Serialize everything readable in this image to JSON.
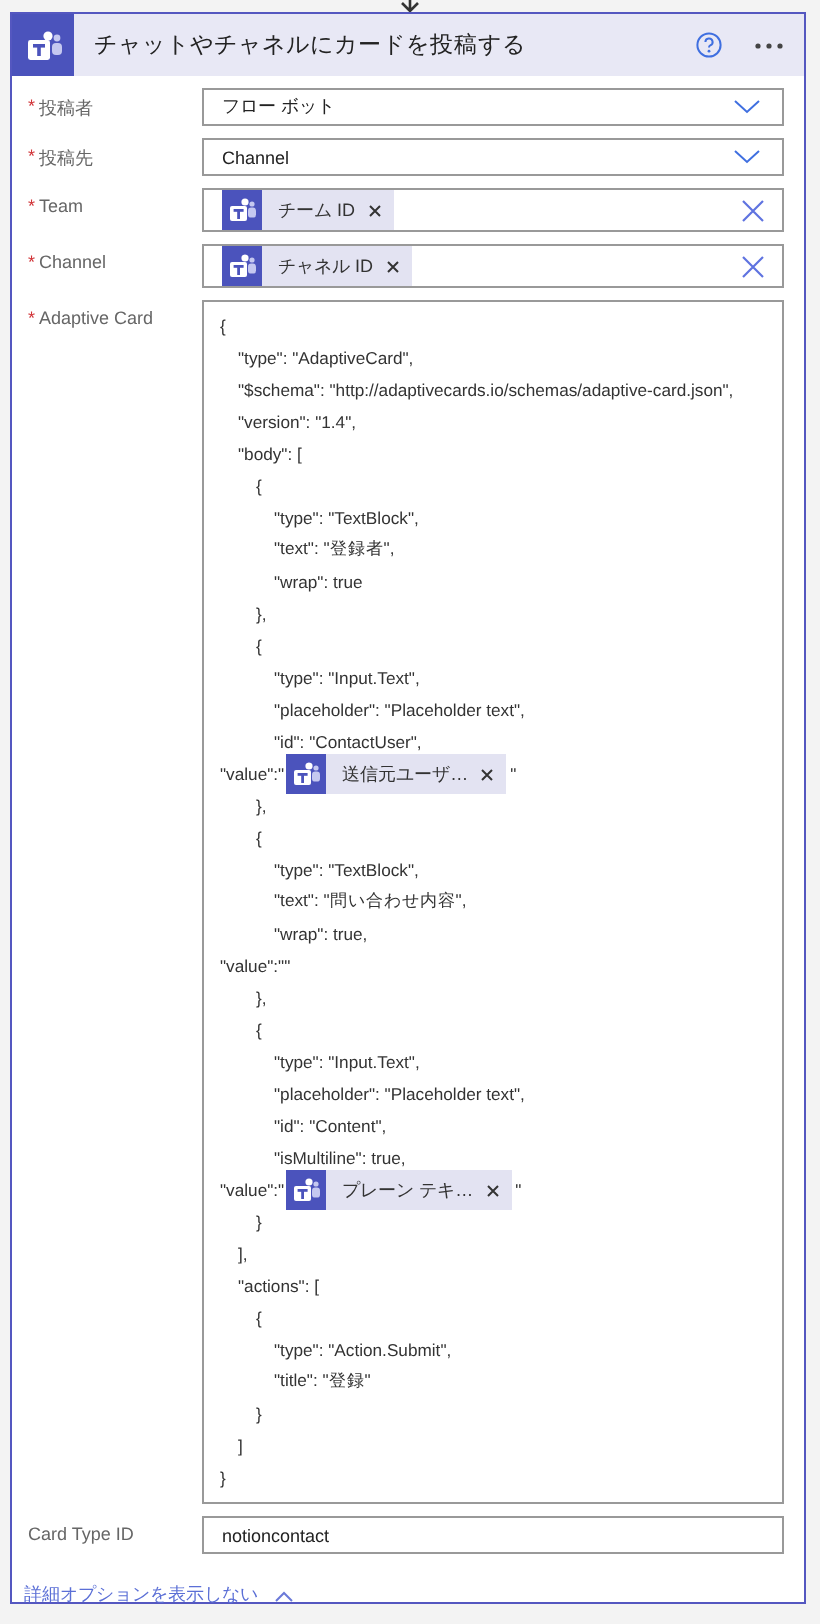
{
  "card": {
    "title": "チャットやチャネルにカードを投稿する"
  },
  "fields": [
    {
      "kind": "dropdown",
      "required_mark": "*",
      "label": "投稿者",
      "value": "フロー ボット"
    },
    {
      "kind": "dropdown",
      "required_mark": "*",
      "label": "投稿先",
      "value": "Channel"
    },
    {
      "kind": "tokens",
      "required_mark": "*",
      "label": "Team",
      "tokens": [
        {
          "label": "チーム ID"
        }
      ]
    },
    {
      "kind": "tokens",
      "required_mark": "*",
      "label": "Channel",
      "tokens": [
        {
          "label": "チャネル ID"
        }
      ]
    },
    {
      "kind": "code",
      "required_mark": "*",
      "label": "Adaptive Card",
      "lines": [
        {
          "text": "{",
          "children": [
            {
              "text": "\"type\": \"AdaptiveCard\","
            },
            {
              "text": "\"$schema\": \"http://adaptivecards.io/schemas/adaptive-card.json\","
            },
            {
              "text": "\"version\": \"1.4\","
            },
            {
              "text": "\"body\": [",
              "children": [
                {
                  "text": "{",
                  "children": [
                    {
                      "text": "\"type\": \"TextBlock\","
                    },
                    {
                      "text": "\"text\": \"登録者\","
                    },
                    {
                      "text": "\"wrap\": true"
                    }
                  ]
                },
                {
                  "text": "},"
                },
                {
                  "text": "{",
                  "children": [
                    {
                      "text": "\"type\": \"Input.Text\","
                    },
                    {
                      "text": "\"placeholder\": \"Placeholder text\","
                    },
                    {
                      "text": "\"id\": \"ContactUser\","
                    },
                    {
                      "kind": "flush_token",
                      "text": "\"value\":\"",
                      "token": "送信元ユーザ…",
                      "after": "\""
                    }
                  ]
                },
                {
                  "text": "},"
                },
                {
                  "text": "{",
                  "children": [
                    {
                      "text": "\"type\": \"TextBlock\","
                    },
                    {
                      "text": "\"text\": \"問い合わせ内容\","
                    },
                    {
                      "text": "\"wrap\": true,"
                    },
                    {
                      "kind": "flush",
                      "text": "\"value\":\"\""
                    }
                  ]
                },
                {
                  "text": "},"
                },
                {
                  "text": "{",
                  "children": [
                    {
                      "text": "\"type\": \"Input.Text\","
                    },
                    {
                      "text": "\"placeholder\": \"Placeholder text\","
                    },
                    {
                      "text": "\"id\": \"Content\","
                    },
                    {
                      "text": "\"isMultiline\": true,"
                    },
                    {
                      "kind": "flush_token",
                      "text": "\"value\":\"",
                      "token": "プレーン テキ…",
                      "after": "\""
                    }
                  ]
                },
                {
                  "text": "}"
                }
              ]
            },
            {
              "text": "],"
            },
            {
              "text": "\"actions\": [",
              "children": [
                {
                  "text": "{",
                  "children": [
                    {
                      "text": "\"type\": \"Action.Submit\","
                    },
                    {
                      "text": "\"title\": \"登録\""
                    }
                  ]
                },
                {
                  "text": "}"
                }
              ]
            },
            {
              "text": "]"
            }
          ]
        },
        {
          "text": "}"
        }
      ]
    },
    {
      "kind": "text",
      "label": "Card Type ID",
      "value": "notioncontact"
    }
  ],
  "advanced_link": "詳細オプションを表示しない"
}
